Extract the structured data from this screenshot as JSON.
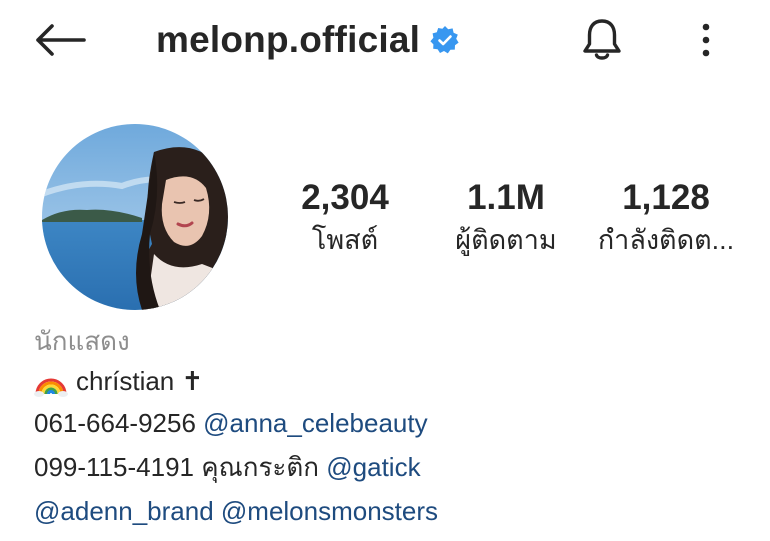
{
  "header": {
    "username": "melonp.official",
    "icons": {
      "back": "arrow-left-icon",
      "verified": "verified-badge-icon",
      "bell": "bell-icon",
      "more": "more-vertical-icon"
    }
  },
  "profile": {
    "avatar": "profile-photo",
    "stats": [
      {
        "value": "2,304",
        "label": "โพสต์"
      },
      {
        "value": "1.1M",
        "label": "ผู้ติดตาม"
      },
      {
        "value": "1,128",
        "label": "กำลังติดต..."
      }
    ]
  },
  "bio": {
    "category": "นักแสดง",
    "line1": {
      "emoji": "rainbow-emoji",
      "text": "chrístian ✝"
    },
    "line2": {
      "text": "061-664-9256",
      "mention": "@anna_celebeauty"
    },
    "line3": {
      "text": "099-115-4191 คุณกระติก",
      "mention": "@gatick"
    },
    "line4": {
      "mention1": "@adenn_brand",
      "mention2": "@melonsmonsters"
    }
  },
  "colors": {
    "verified": "#3897f0",
    "mention": "#1e4b7f",
    "category": "#8e8e8e",
    "text": "#262626"
  }
}
